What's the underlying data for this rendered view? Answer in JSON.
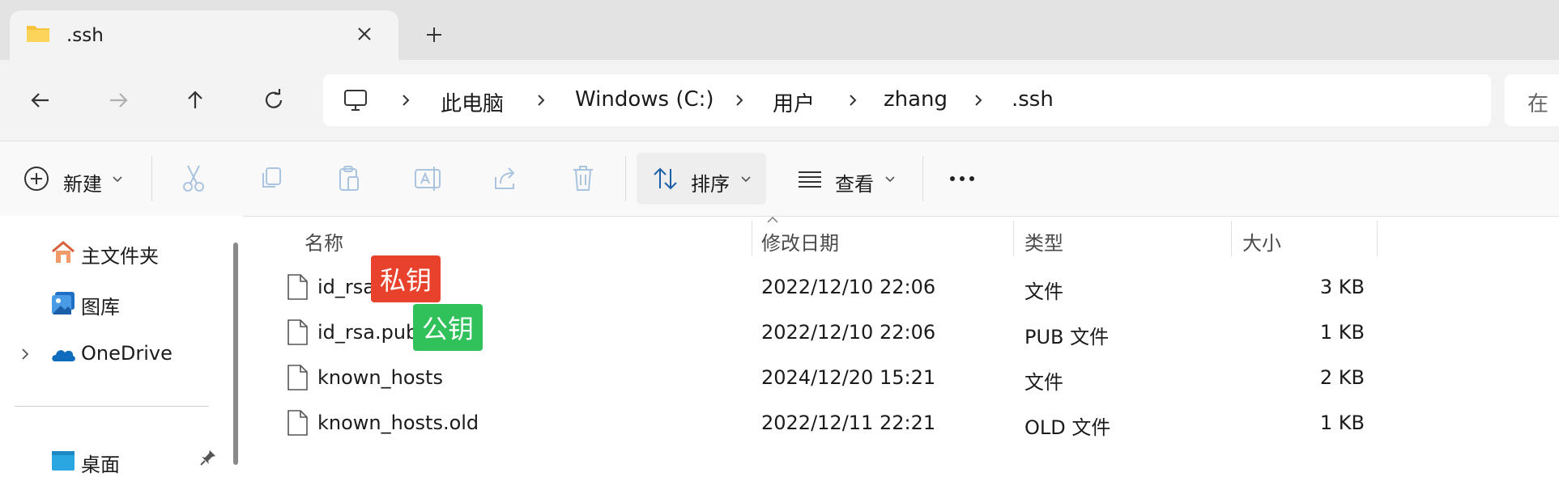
{
  "tab": {
    "title": ".ssh"
  },
  "breadcrumb": [
    {
      "label": "此电脑"
    },
    {
      "label": "Windows (C:)"
    },
    {
      "label": "用户"
    },
    {
      "label": "zhang"
    },
    {
      "label": ".ssh"
    }
  ],
  "search": {
    "partial_text": "在"
  },
  "toolbar": {
    "new_label": "新建",
    "sort_label": "排序",
    "view_label": "查看"
  },
  "sidebar": {
    "items": [
      {
        "label": "主文件夹"
      },
      {
        "label": "图库"
      },
      {
        "label": "OneDrive"
      },
      {
        "label": "桌面"
      }
    ]
  },
  "columns": {
    "name": "名称",
    "modified": "修改日期",
    "type": "类型",
    "size": "大小"
  },
  "files": [
    {
      "name": "id_rsa",
      "modified": "2022/12/10 22:06",
      "type": "文件",
      "size": "3 KB",
      "tag": "私钥"
    },
    {
      "name": "id_rsa.pub",
      "modified": "2022/12/10 22:06",
      "type": "PUB 文件",
      "size": "1 KB",
      "tag": "公钥"
    },
    {
      "name": "known_hosts",
      "modified": "2024/12/20 15:21",
      "type": "文件",
      "size": "2 KB"
    },
    {
      "name": "known_hosts.old",
      "modified": "2022/12/11 22:21",
      "type": "OLD 文件",
      "size": "1 KB"
    }
  ],
  "colors": {
    "private_tag": "#e8412c",
    "public_tag": "#31c15a",
    "folder": "#f8c33a",
    "onedrive": "#0f6cbd"
  }
}
